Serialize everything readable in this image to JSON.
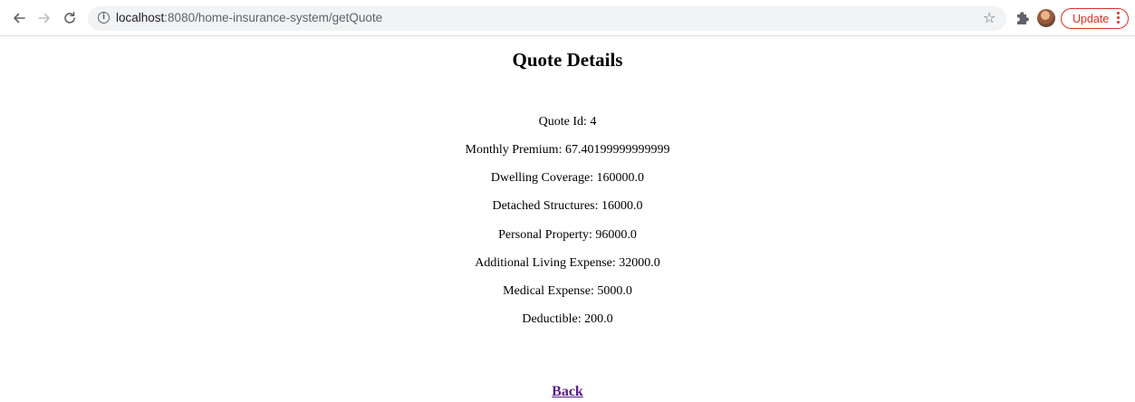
{
  "browser": {
    "url_host": "localhost",
    "url_path": ":8080/home-insurance-system/getQuote",
    "update_label": "Update",
    "icons": {
      "back": "back-arrow-icon",
      "forward": "forward-arrow-icon",
      "reload": "reload-icon",
      "info": "info-icon",
      "bookmark": "star-icon",
      "extensions": "puzzle-piece-icon",
      "profile": "avatar",
      "menu": "kebab-menu-icon"
    },
    "colors": {
      "update_accent": "#d93025",
      "omnibox_bg": "#f1f3f4"
    }
  },
  "page": {
    "title": "Quote Details",
    "details": [
      "Quote Id: 4",
      "Monthly Premium: 67.40199999999999",
      "Dwelling Coverage: 160000.0",
      "Detached Structures: 16000.0",
      "Personal Property: 96000.0",
      "Additional Living Expense: 32000.0",
      "Medical Expense: 5000.0",
      "Deductible: 200.0"
    ],
    "back_link": "Back",
    "colors": {
      "link_visited": "#551a8b"
    }
  }
}
